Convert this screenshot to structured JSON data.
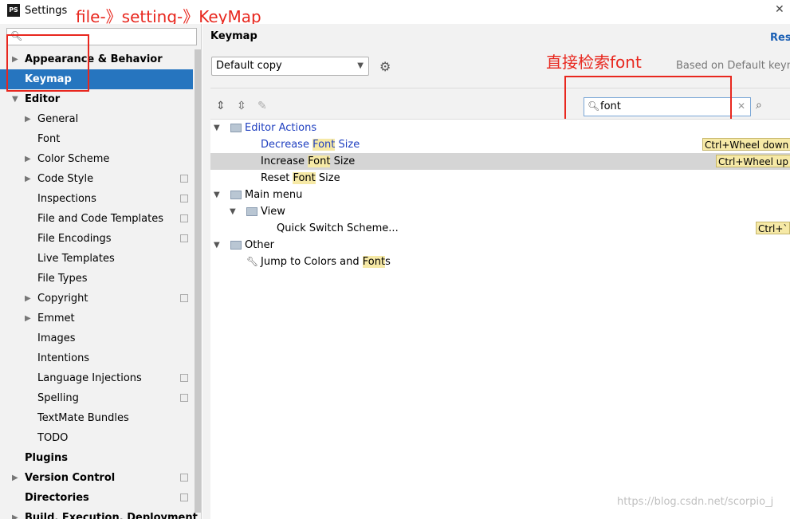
{
  "window": {
    "title": "Settings",
    "app_icon_text": "PS"
  },
  "annotations": {
    "path": "file-》setting-》KeyMap",
    "search_hint": "直接检索font"
  },
  "sidebar": {
    "search_placeholder": "",
    "items": [
      {
        "label": "Appearance & Behavior"
      },
      {
        "label": "Keymap"
      },
      {
        "label": "Editor"
      },
      {
        "label": "General"
      },
      {
        "label": "Font"
      },
      {
        "label": "Color Scheme"
      },
      {
        "label": "Code Style"
      },
      {
        "label": "Inspections"
      },
      {
        "label": "File and Code Templates"
      },
      {
        "label": "File Encodings"
      },
      {
        "label": "Live Templates"
      },
      {
        "label": "File Types"
      },
      {
        "label": "Copyright"
      },
      {
        "label": "Emmet"
      },
      {
        "label": "Images"
      },
      {
        "label": "Intentions"
      },
      {
        "label": "Language Injections"
      },
      {
        "label": "Spelling"
      },
      {
        "label": "TextMate Bundles"
      },
      {
        "label": "TODO"
      },
      {
        "label": "Plugins"
      },
      {
        "label": "Version Control"
      },
      {
        "label": "Directories"
      },
      {
        "label": "Build, Execution, Deployment"
      }
    ]
  },
  "keymap": {
    "title": "Keymap",
    "reset_label": "Rese",
    "selected_keymap": "Default copy",
    "based_on": "Based on Default keyma",
    "filter_value": "font",
    "actions": [
      {
        "label_pre": "Editor Actions",
        "label_hl": "",
        "label_post": ""
      },
      {
        "label_pre": "Decrease ",
        "label_hl": "Font",
        "label_post": " Size",
        "shortcut": "Ctrl+Wheel down"
      },
      {
        "label_pre": "Increase ",
        "label_hl": "Font",
        "label_post": " Size",
        "shortcut": "Ctrl+Wheel up"
      },
      {
        "label_pre": "Reset ",
        "label_hl": "Font",
        "label_post": " Size"
      },
      {
        "label_pre": "Main menu",
        "label_hl": "",
        "label_post": ""
      },
      {
        "label_pre": "View",
        "label_hl": "",
        "label_post": ""
      },
      {
        "label_pre": "Quick Switch Scheme...",
        "label_hl": "",
        "label_post": "",
        "shortcut": "Ctrl+`"
      },
      {
        "label_pre": "Other",
        "label_hl": "",
        "label_post": ""
      },
      {
        "label_pre": "Jump to Colors and ",
        "label_hl": "Font",
        "label_post": "s"
      }
    ]
  },
  "watermark": "https://blog.csdn.net/scorpio_j",
  "colors": {
    "selection": "#2675bf",
    "annotation": "#e8271e",
    "match_highlight": "#f6e9a6"
  }
}
